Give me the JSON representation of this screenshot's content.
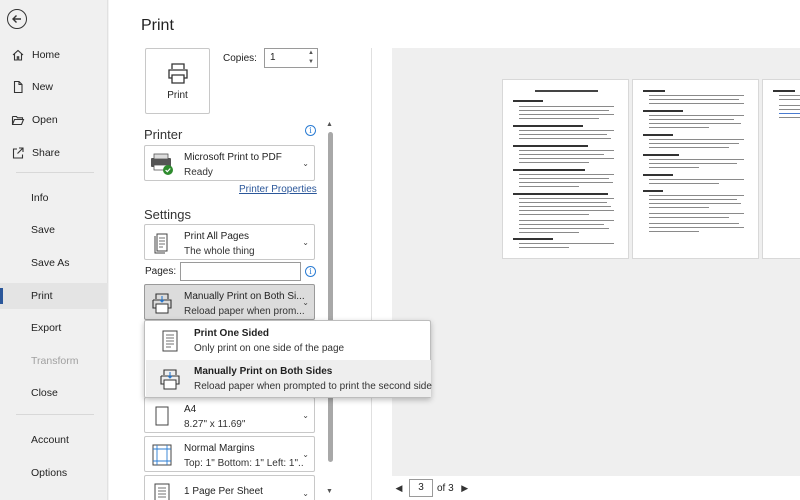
{
  "nav": {
    "back_label": "Back",
    "items": [
      {
        "label": "Home"
      },
      {
        "label": "New"
      },
      {
        "label": "Open"
      },
      {
        "label": "Share"
      },
      {
        "label": "Info"
      },
      {
        "label": "Save"
      },
      {
        "label": "Save As"
      },
      {
        "label": "Print"
      },
      {
        "label": "Export"
      },
      {
        "label": "Transform"
      },
      {
        "label": "Close"
      },
      {
        "label": "Account"
      },
      {
        "label": "Options"
      }
    ]
  },
  "print": {
    "title": "Print",
    "button_label": "Print",
    "copies_label": "Copies:",
    "copies_value": "1"
  },
  "printer": {
    "heading": "Printer",
    "name": "Microsoft Print to PDF",
    "status": "Ready",
    "properties_link": "Printer Properties"
  },
  "settings": {
    "heading": "Settings",
    "range_title": "Print All Pages",
    "range_desc": "The whole thing",
    "pages_label": "Pages:",
    "pages_value": "",
    "sides_title": "Manually Print on Both Si...",
    "sides_desc": "Reload paper when prom...",
    "paper_title": "A4",
    "paper_desc": "8.27\" x 11.69\"",
    "margins_title": "Normal Margins",
    "margins_desc": "Top: 1\" Bottom: 1\" Left: 1\"...",
    "per_sheet_title": "1 Page Per Sheet"
  },
  "sides_menu": {
    "options": [
      {
        "title": "Print One Sided",
        "desc": "Only print on one side of the page"
      },
      {
        "title": "Manually Print on Both Sides",
        "desc": "Reload paper when prompted to print the second side"
      }
    ]
  },
  "preview": {
    "current_page": "3",
    "total_label": "of 3"
  }
}
